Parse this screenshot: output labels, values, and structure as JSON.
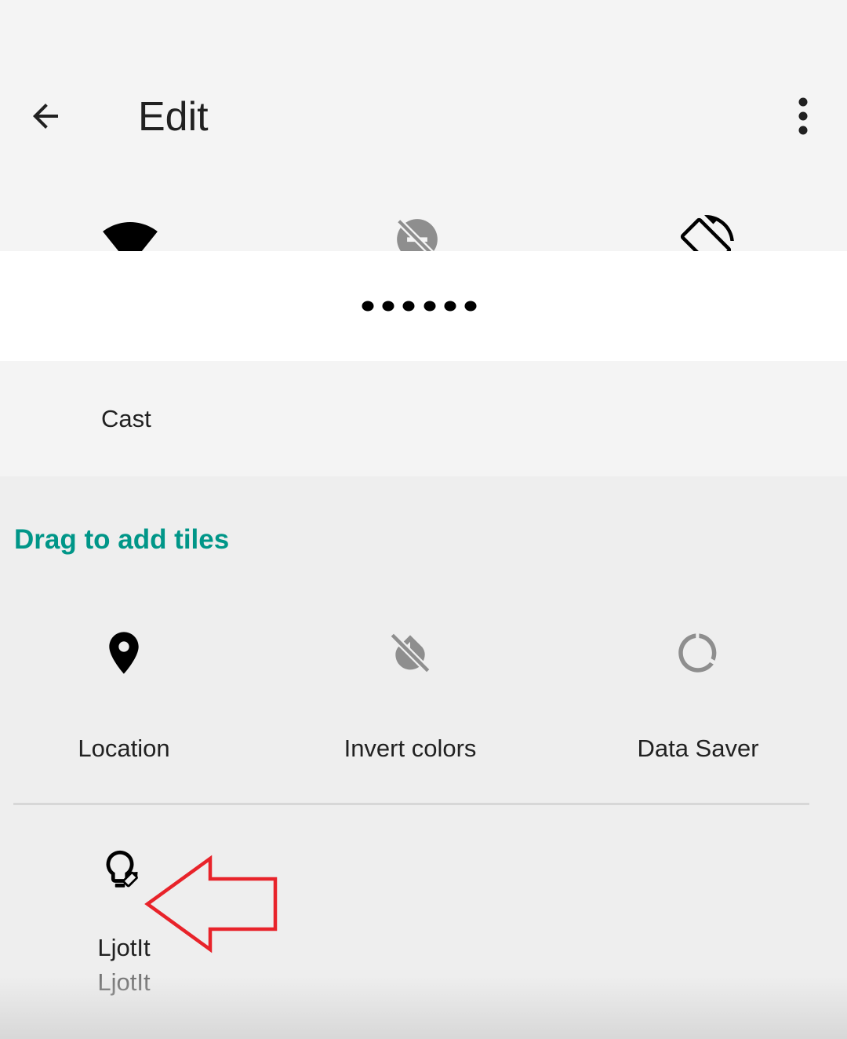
{
  "toolbar": {
    "title": "Edit",
    "back_icon": "arrow-back-icon",
    "menu_icon": "more-vert-icon"
  },
  "current_tiles": [
    {
      "icon": "wifi-icon"
    },
    {
      "icon": "do-not-disturb-off-icon"
    },
    {
      "icon": "auto-rotate-icon"
    }
  ],
  "masked_text": "••••••",
  "cast": {
    "label": "Cast"
  },
  "add_tiles": {
    "header": "Drag to add tiles",
    "tiles": [
      {
        "label": "Location",
        "icon": "location-pin-icon"
      },
      {
        "label": "Invert colors",
        "icon": "invert-colors-off-icon"
      },
      {
        "label": "Data Saver",
        "icon": "data-saver-icon"
      }
    ],
    "third_party": {
      "label": "LjotIt",
      "sublabel": "LjotIt",
      "icon": "lightbulb-edit-icon"
    }
  },
  "annotation": {
    "icon": "red-arrow-icon",
    "color": "#e8232a"
  },
  "colors": {
    "accent": "#009688",
    "background": "#f4f4f4",
    "tiles_area": "#eeeeee"
  }
}
